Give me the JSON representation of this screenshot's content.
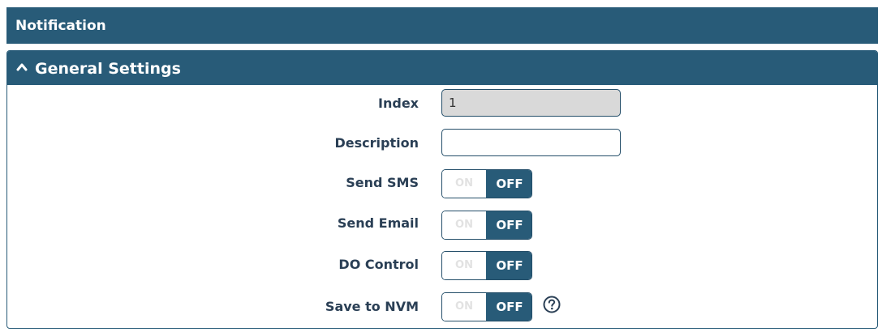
{
  "page": {
    "title": "Notification"
  },
  "section": {
    "title": "General Settings"
  },
  "fields": {
    "index": {
      "label": "Index",
      "value": "1"
    },
    "description": {
      "label": "Description",
      "value": "",
      "placeholder": ""
    },
    "send_sms": {
      "label": "Send SMS",
      "on_label": "ON",
      "off_label": "OFF",
      "state": "OFF"
    },
    "send_email": {
      "label": "Send Email",
      "on_label": "ON",
      "off_label": "OFF",
      "state": "OFF"
    },
    "do_control": {
      "label": "DO Control",
      "on_label": "ON",
      "off_label": "OFF",
      "state": "OFF"
    },
    "save_to_nvm": {
      "label": "Save to NVM",
      "on_label": "ON",
      "off_label": "OFF",
      "state": "OFF"
    }
  },
  "icons": {
    "section_toggle": "chevron-up-icon",
    "help": "question-circle-icon"
  },
  "colors": {
    "header_bg": "#285b78",
    "label_text": "#2a3f55",
    "readonly_bg": "#d9d9d9"
  }
}
